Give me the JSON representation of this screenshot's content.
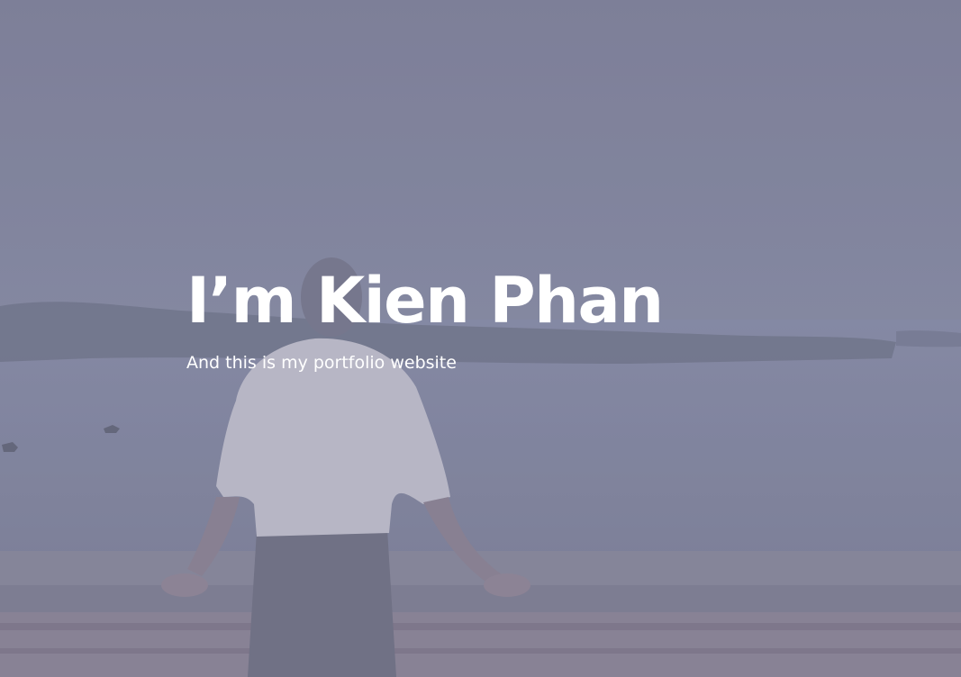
{
  "hero": {
    "title": "I’m Kien Phan",
    "subtitle": "And this is my portfolio website",
    "background_image": "man-looking-at-lake-photo"
  },
  "colors": {
    "overlay": "#7f8198",
    "text": "#ffffff"
  }
}
